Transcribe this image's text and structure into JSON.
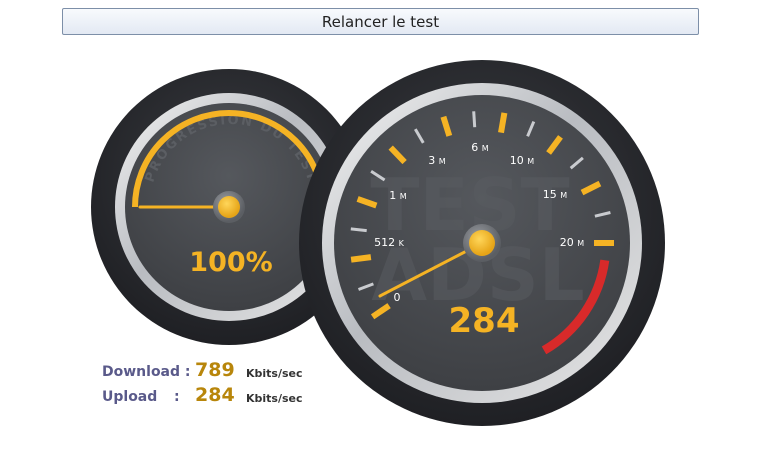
{
  "toolbar": {
    "retest_label": "Relancer le test"
  },
  "progress_gauge": {
    "title": "PROGRESSION DU TEST",
    "percent": 100,
    "display": "100%"
  },
  "speed_gauge": {
    "watermark_line1": "TEST",
    "watermark_line2": "ADSL",
    "value": 284,
    "display": "284",
    "scale_labels": [
      {
        "num": "0",
        "unit": ""
      },
      {
        "num": "512",
        "unit": "K"
      },
      {
        "num": "1",
        "unit": "M"
      },
      {
        "num": "3",
        "unit": "M"
      },
      {
        "num": "6",
        "unit": "M"
      },
      {
        "num": "10",
        "unit": "M"
      },
      {
        "num": "15",
        "unit": "M"
      },
      {
        "num": "20",
        "unit": "M"
      }
    ]
  },
  "results": {
    "download": {
      "label": "Download :",
      "value": "789",
      "unit": "Kbits/sec"
    },
    "upload": {
      "label": "Upload",
      "separator": ":",
      "value": "284",
      "unit": "Kbits/sec"
    }
  },
  "colors": {
    "accent": "#f5b324",
    "needle_hub": "#f5b324",
    "dial_face": "#4a4c50",
    "redline": "#d82a2a",
    "label_text": "#5a5a8a",
    "value_text": "#b8860b"
  }
}
